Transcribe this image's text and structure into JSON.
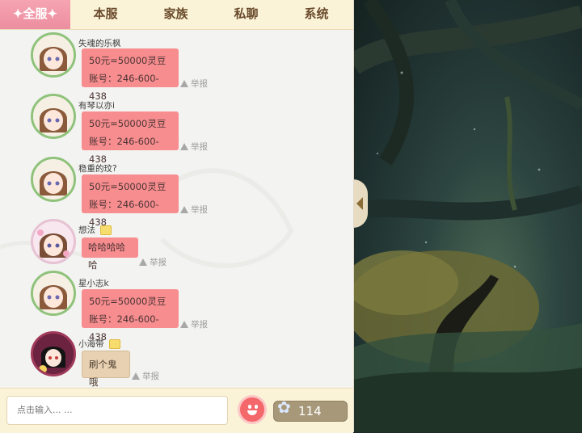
{
  "tabs": [
    {
      "label": "✦全服✦",
      "active": true
    },
    {
      "label": "本服",
      "active": false
    },
    {
      "label": "家族",
      "active": false
    },
    {
      "label": "私聊",
      "active": false
    },
    {
      "label": "系统",
      "active": false
    }
  ],
  "messages": [
    {
      "name": "失魂的乐枫",
      "lines": [
        "50元=50000灵豆",
        "账号：246-600-438"
      ],
      "report": "举报"
    },
    {
      "name": "有琴以亦i",
      "lines": [
        "50元=50000灵豆",
        "账号：246-600-438"
      ],
      "report": "举报"
    },
    {
      "name": "稳重的玟?",
      "lines": [
        "50元=50000灵豆",
        "账号：246-600-438"
      ],
      "report": "举报"
    },
    {
      "name": "想法",
      "lines": [
        "哈哈哈哈哈"
      ],
      "report": "举报"
    },
    {
      "name": "星小志k",
      "lines": [
        "50元=50000灵豆",
        "账号：246-600-438"
      ],
      "report": "举报"
    },
    {
      "name": "小海带",
      "lines": [
        "刷个鬼哦"
      ],
      "report": "举报"
    }
  ],
  "input": {
    "placeholder": "点击输入... ..."
  },
  "currency": {
    "count": "114",
    "icon": "flower-icon"
  },
  "colors": {
    "tab_active": "#ec8ea0",
    "bubble": "#f88d8f",
    "bubble_alt": "#e7d1b2",
    "bar": "#fbf3d8"
  }
}
